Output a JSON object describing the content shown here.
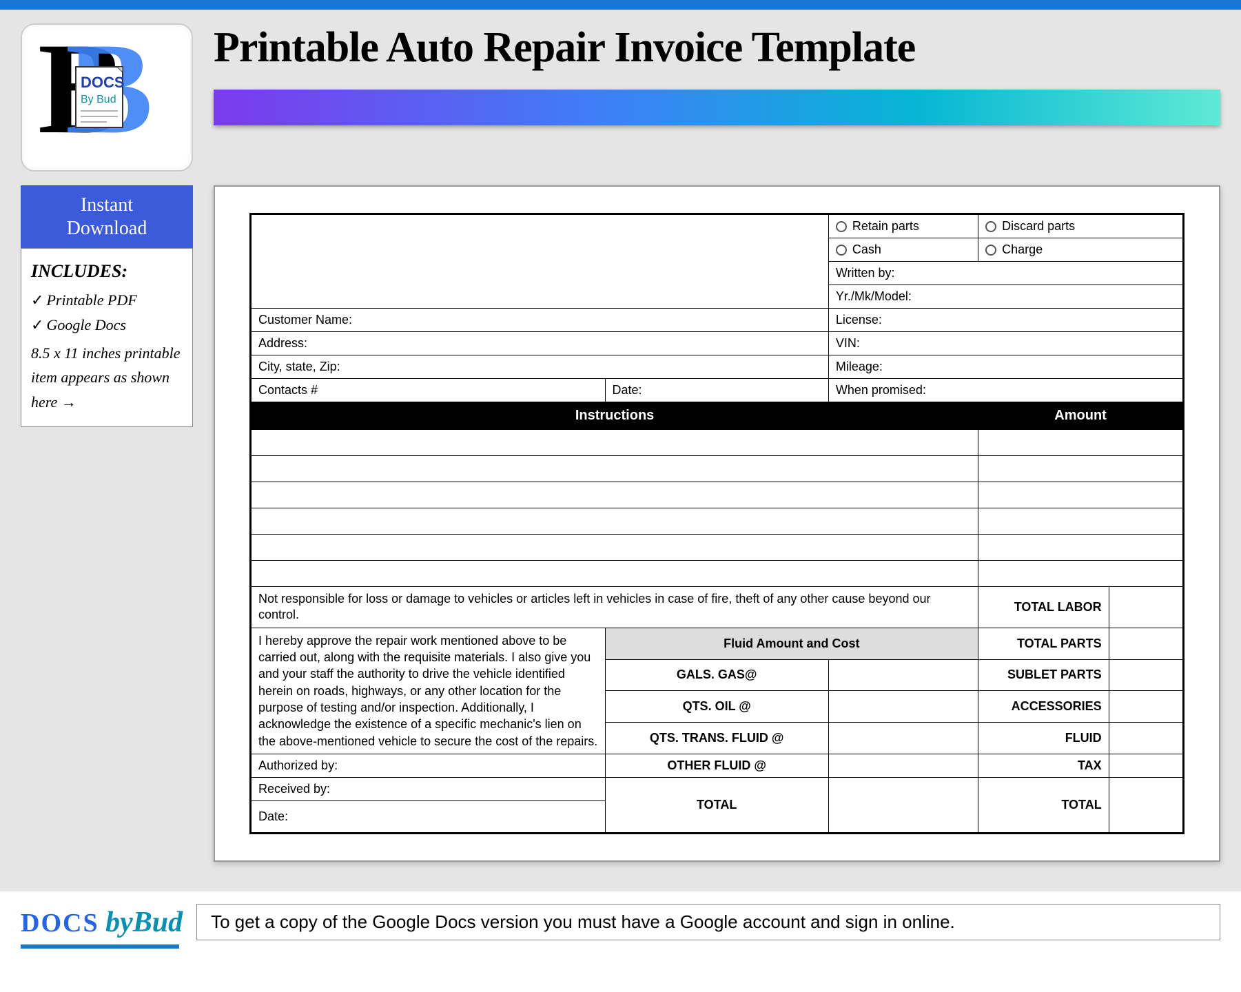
{
  "page": {
    "title": "Printable Auto Repair Invoice Template"
  },
  "sidebar": {
    "badge_line1": "Instant",
    "badge_line2": "Download",
    "includes_title": "INCLUDES:",
    "item1": "Printable PDF",
    "item2": "Google Docs",
    "size_note": "8.5 x 11 inches printable item appears as shown here →"
  },
  "logo": {
    "docs": "DOCS",
    "bybud": "By Bud"
  },
  "invoice": {
    "retain_parts": "Retain parts",
    "discard_parts": "Discard parts",
    "cash": "Cash",
    "charge": "Charge",
    "written_by": "Written by:",
    "yr_mk_model": "Yr./Mk/Model:",
    "customer_name": "Customer Name:",
    "license": "License:",
    "address": "Address:",
    "vin": "VIN:",
    "city_state_zip": "City, state, Zip:",
    "mileage": "Mileage:",
    "contacts": "Contacts #",
    "date": "Date:",
    "when_promised": "When promised:",
    "instructions_header": "Instructions",
    "amount_header": "Amount",
    "disclaimer": "Not responsible for loss or damage to vehicles or articles left in vehicles in case of fire, theft of any other cause beyond our control.",
    "approval_text": "I hereby approve the repair work mentioned above to be carried out, along with the requisite materials. I also give you and your staff the authority to drive the vehicle identified herein on roads, highways, or any other location for the purpose of testing and/or inspection. Additionally, I acknowledge the existence of a specific mechanic's lien on the above-mentioned vehicle to secure the cost of the repairs.",
    "authorized_by": "Authorized by:",
    "received_by": "Received by:",
    "date2": "Date:",
    "fluid_header": "Fluid Amount and Cost",
    "gals_gas": "GALS. GAS@",
    "qts_oil": "QTS. OIL @",
    "qts_trans": "QTS. TRANS. FLUID @",
    "other_fluid": "OTHER FLUID @",
    "fluid_total": "TOTAL",
    "total_labor": "TOTAL LABOR",
    "total_parts": "TOTAL PARTS",
    "sublet_parts": "SUBLET PARTS",
    "accessories": "ACCESSORIES",
    "fluid": "FLUID",
    "tax": "TAX",
    "total": "TOTAL"
  },
  "footer": {
    "docs": "DOCS",
    "bybud": "byBud",
    "note": "To get a copy of the Google Docs version you must have a Google account and sign in online."
  }
}
